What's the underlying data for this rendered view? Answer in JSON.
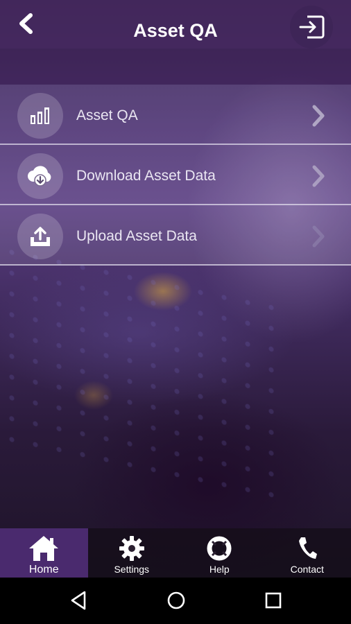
{
  "header": {
    "title": "Asset QA",
    "back_icon": "chevron-left-icon",
    "logout_icon": "logout-icon"
  },
  "menu": {
    "items": [
      {
        "label": "Asset QA",
        "icon": "bar-chart-icon"
      },
      {
        "label": "Download Asset Data",
        "icon": "cloud-download-icon"
      },
      {
        "label": "Upload Asset Data",
        "icon": "tray-upload-icon"
      }
    ]
  },
  "bottom_nav": {
    "items": [
      {
        "label": "Home",
        "icon": "home-icon",
        "active": true
      },
      {
        "label": "Settings",
        "icon": "gear-icon",
        "active": false
      },
      {
        "label": "Help",
        "icon": "lifebuoy-icon",
        "active": false
      },
      {
        "label": "Contact",
        "icon": "phone-icon",
        "active": false
      }
    ]
  },
  "system_nav": {
    "buttons": [
      "back-triangle-icon",
      "home-circle-icon",
      "recents-square-icon"
    ]
  },
  "colors": {
    "active_tab": "#4a2a6e",
    "header": "#46285f",
    "text_primary": "#ffffff"
  }
}
